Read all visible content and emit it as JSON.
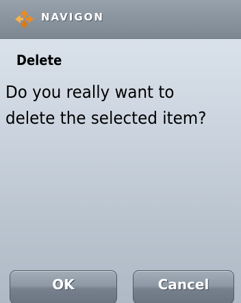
{
  "header": {
    "brand": "NAVIGON",
    "logo_icon": "navigon-diamond-arrows-icon",
    "colors": {
      "arrow_orange": "#f08a1c",
      "arrow_orange_light": "#f7b24a"
    }
  },
  "dialog": {
    "title": "Delete",
    "message": "Do you really want to delete the selected item?"
  },
  "buttons": {
    "ok_label": "OK",
    "cancel_label": "Cancel"
  }
}
